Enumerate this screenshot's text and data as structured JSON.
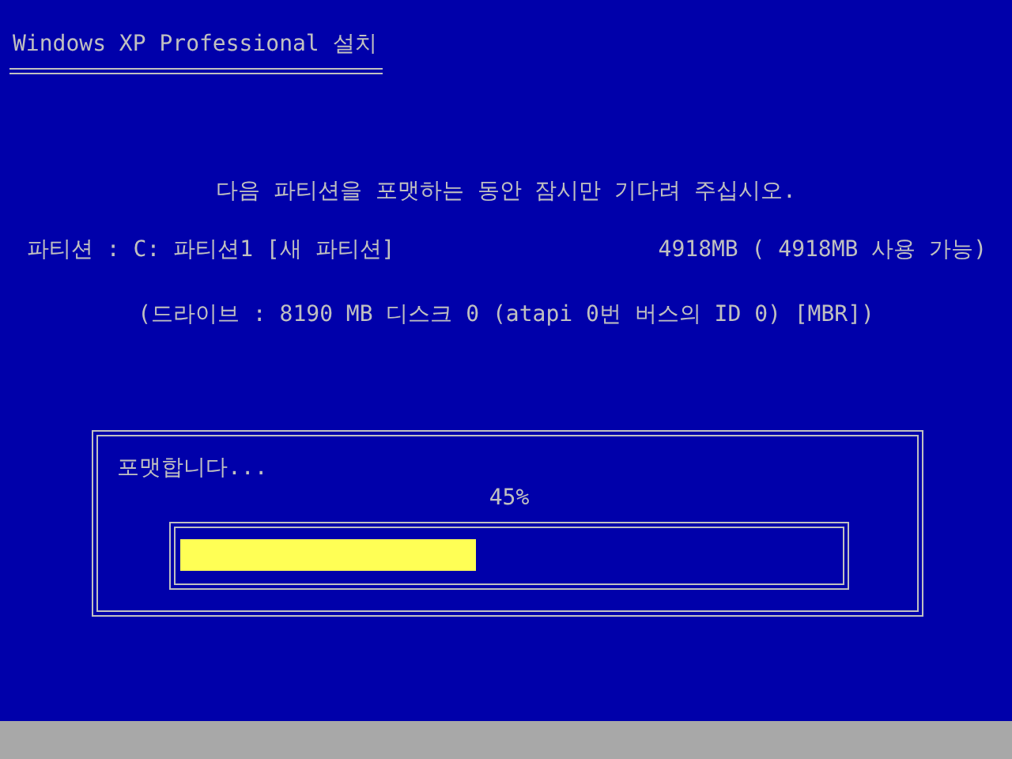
{
  "window": {
    "title": "Windows XP Professional 설치"
  },
  "message": "다음 파티션을 포맷하는 동안 잠시만 기다려 주십시오.",
  "partition": {
    "name": "파티션 : C: 파티션1 [새 파티션]",
    "size": "4918MB ( 4918MB 사용 가능)"
  },
  "drive": "(드라이브 : 8190 MB 디스크 0 (atapi 0번 버스의 ID 0) [MBR])",
  "progress": {
    "label": "포맷합니다...",
    "reading": "45%",
    "level": 0.45
  }
}
